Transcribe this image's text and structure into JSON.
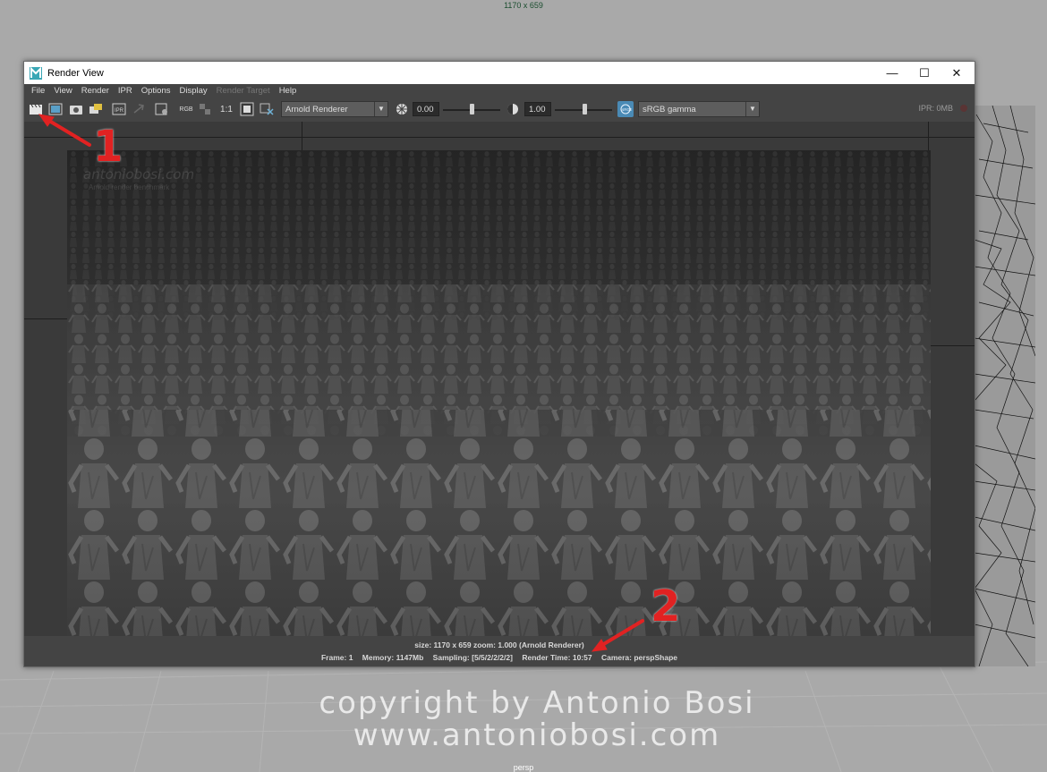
{
  "viewport": {
    "resolution": "1170 x 659",
    "camera_label": "persp"
  },
  "copyright": {
    "line1": "copyright by Antonio Bosi",
    "line2": "www.antoniobosi.com"
  },
  "window": {
    "title": "Render View",
    "controls": {
      "minimize": "—",
      "maximize": "☐",
      "close": "✕"
    }
  },
  "menu": {
    "file": "File",
    "view": "View",
    "render": "Render",
    "ipr": "IPR",
    "options": "Options",
    "display": "Display",
    "render_target": "Render Target",
    "help": "Help"
  },
  "toolbar": {
    "rgb_label": "RGB",
    "ratio_label": "1:1",
    "renderer": "Arnold Renderer",
    "exposure": "0.00",
    "gamma": "1.00",
    "color_space": "sRGB gamma",
    "ipr_memory": "IPR: 0MB"
  },
  "render_image": {
    "watermark_main": "antoniobosi.com",
    "watermark_sub": "Arnold render benchmark"
  },
  "status": {
    "line1": "size: 1170 x 659 zoom: 1.000     (Arnold Renderer)",
    "frame": "Frame: 1",
    "memory": "Memory: 1147Mb",
    "sampling": "Sampling: [5/5/2/2/2/2]",
    "render_time": "Render Time: 10:57",
    "camera": "Camera: perspShape"
  },
  "annotations": {
    "first": "1",
    "second": "2"
  },
  "colors": {
    "annotation": "#e12222",
    "window_bg": "#444444",
    "viewport_bg": "#a9a9a9"
  }
}
